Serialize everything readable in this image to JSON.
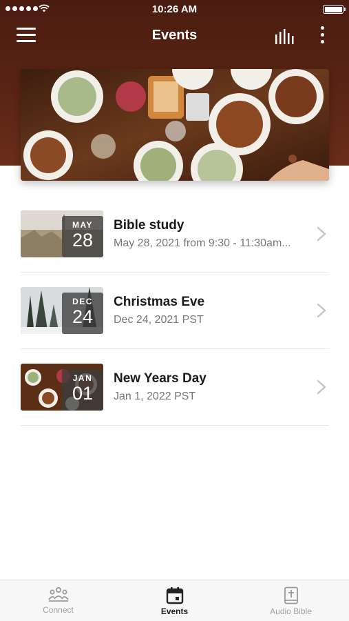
{
  "status_bar": {
    "time": "10:26 AM",
    "signal-icon": "signal-dots",
    "wifi-icon": "wifi",
    "battery-icon": "battery-full"
  },
  "nav": {
    "title": "Events",
    "menu_icon": "hamburger-icon",
    "bars_icon": "audio-bars-icon",
    "more_icon": "vertical-dots-icon"
  },
  "hero": {
    "image": "overhead view of dinner table with food plates"
  },
  "events": [
    {
      "title": "Bible study",
      "subtitle": "May 28, 2021 from 9:30 - 11:30am...",
      "month": "MAY",
      "day": "28",
      "thumb": "field-grass"
    },
    {
      "title": "Christmas Eve",
      "subtitle": "Dec 24, 2021 PST",
      "month": "DEC",
      "day": "24",
      "thumb": "snowy-forest"
    },
    {
      "title": "New Years Day",
      "subtitle": "Jan 1, 2022 PST",
      "month": "JAN",
      "day": "01",
      "thumb": "dinner-table"
    }
  ],
  "tabs": [
    {
      "label": "Connect",
      "icon": "people-icon",
      "active": false
    },
    {
      "label": "Events",
      "icon": "calendar-icon",
      "active": true
    },
    {
      "label": "Audio Bible",
      "icon": "bible-icon",
      "active": false
    }
  ],
  "colors": {
    "header": "#5a2414",
    "accent": "#222222",
    "inactive": "#a0a0a0"
  }
}
